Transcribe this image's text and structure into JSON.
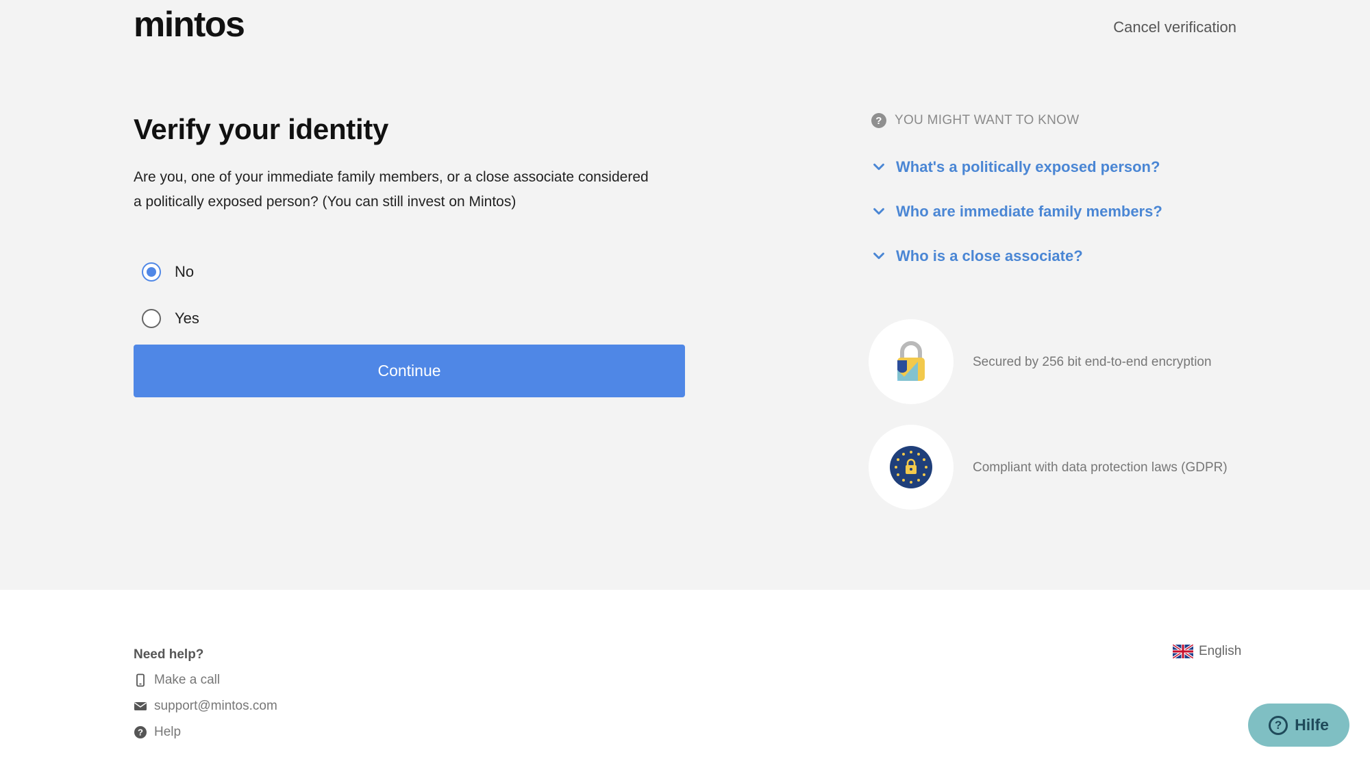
{
  "header": {
    "logo": "mintos",
    "cancel_label": "Cancel verification"
  },
  "main": {
    "title": "Verify your identity",
    "question": "Are you, one of your immediate family members, or a close associate considered a politically exposed person? (You can still invest on Mintos)",
    "options": [
      {
        "label": "No",
        "checked": true
      },
      {
        "label": "Yes",
        "checked": false
      }
    ],
    "continue_label": "Continue"
  },
  "aside": {
    "header": "YOU MIGHT WANT TO KNOW",
    "faq": [
      {
        "label": "What's a politically exposed person?"
      },
      {
        "label": "Who are immediate family members?"
      },
      {
        "label": "Who is a close associate?"
      }
    ],
    "badges": [
      {
        "icon": "lock-icon",
        "text": "Secured by 256 bit end-to-end encryption"
      },
      {
        "icon": "eu-lock-icon",
        "text": "Compliant with data protection laws (GDPR)"
      }
    ]
  },
  "footer": {
    "help_title": "Need help?",
    "links": [
      {
        "icon": "phone-icon",
        "label": "Make a call"
      },
      {
        "icon": "mail-icon",
        "label": "support@mintos.com"
      },
      {
        "icon": "help-icon",
        "label": "Help"
      }
    ],
    "language": "English"
  },
  "help_widget": {
    "label": "Hilfe"
  },
  "colors": {
    "primary": "#4f87e6",
    "link": "#4a86d4",
    "help_widget": "#7fbfc3",
    "background": "#f3f3f3"
  }
}
